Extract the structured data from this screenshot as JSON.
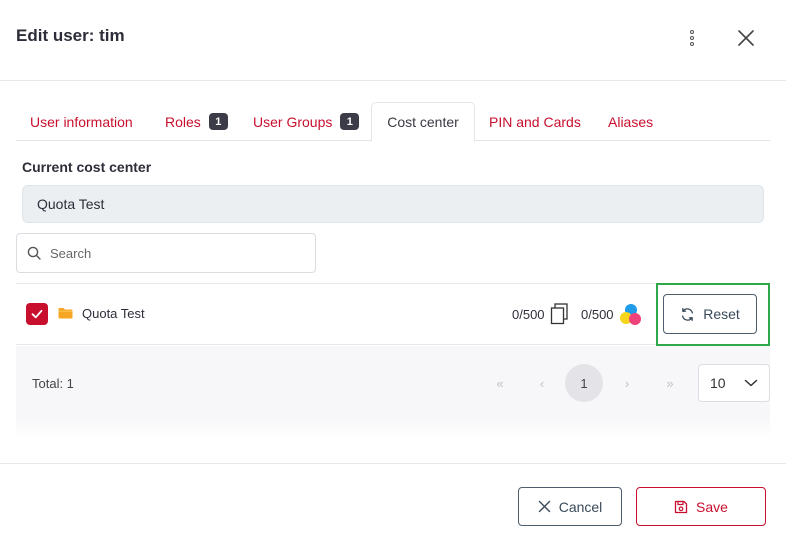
{
  "dialog": {
    "title": "Edit user: tim"
  },
  "header_icons": [
    "kebab-menu-icon",
    "close-icon"
  ],
  "tabs": [
    {
      "label": "User information",
      "active": false
    },
    {
      "label": "Roles",
      "badge": "1",
      "active": false
    },
    {
      "label": "User Groups",
      "badge": "1",
      "active": false
    },
    {
      "label": "Cost center",
      "active": true
    },
    {
      "label": "PIN and Cards",
      "active": false
    },
    {
      "label": "Aliases",
      "active": false
    }
  ],
  "current_cost_center": {
    "label": "Current cost center",
    "value": "Quota Test"
  },
  "search": {
    "placeholder": "Search",
    "value": ""
  },
  "rows": [
    {
      "checked": true,
      "name": "Quota Test",
      "quota_pages": "0/500",
      "quota_color": "0/500",
      "reset_label": "Reset"
    }
  ],
  "pagination": {
    "total": "Total: 1",
    "current_page": "1",
    "first": "«",
    "prev": "‹",
    "next": "›",
    "last": "»",
    "page_size": "10"
  },
  "footer": {
    "cancel_label": "Cancel",
    "save_label": "Save"
  },
  "colors": {
    "accent": "#c8102e",
    "highlight": "#2ea84a",
    "folder": "#f5a623"
  }
}
